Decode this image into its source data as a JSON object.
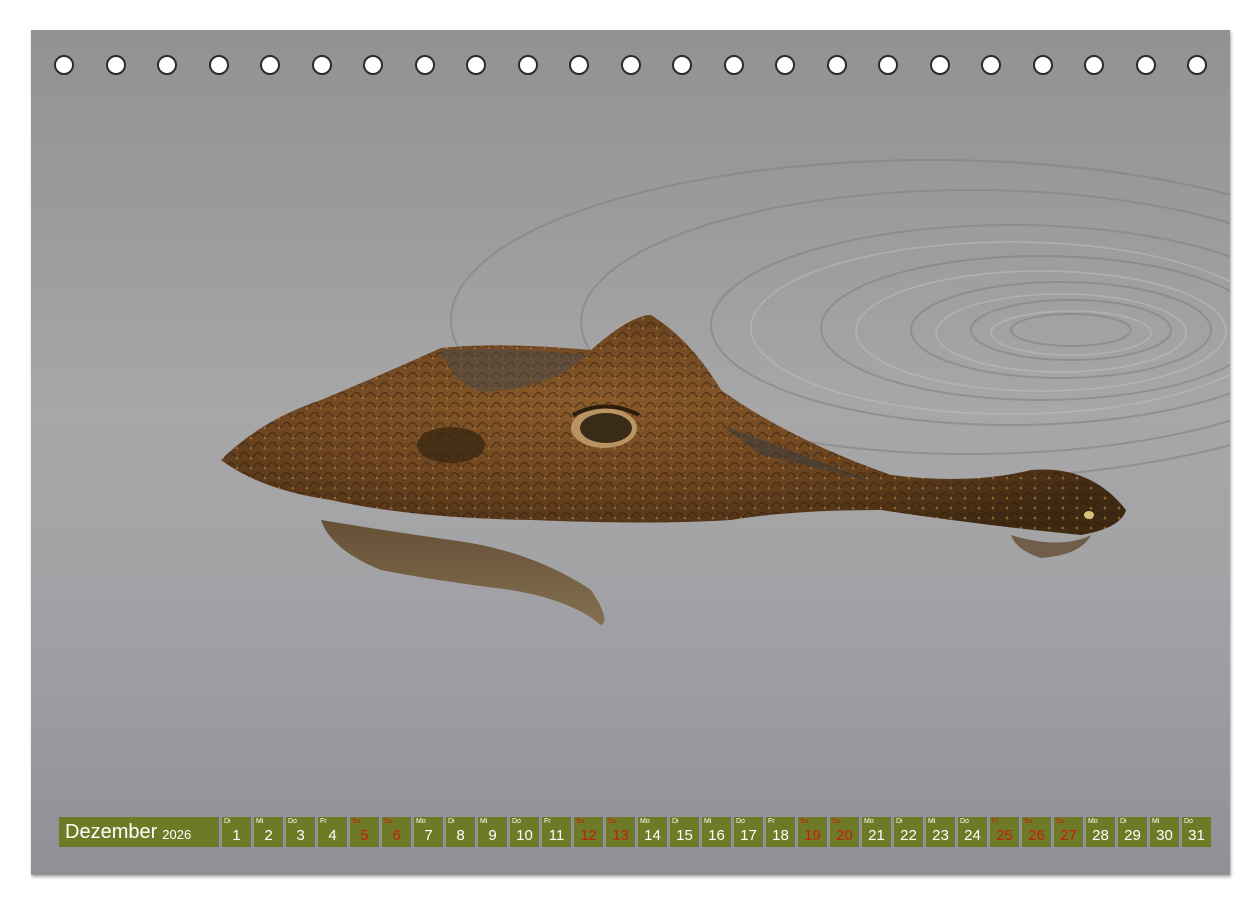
{
  "calendar": {
    "month": "Dezember",
    "year": "2026",
    "days": [
      {
        "num": "1",
        "wd": "Di",
        "red": false
      },
      {
        "num": "2",
        "wd": "Mi",
        "red": false
      },
      {
        "num": "3",
        "wd": "Do",
        "red": false
      },
      {
        "num": "4",
        "wd": "Fr",
        "red": false
      },
      {
        "num": "5",
        "wd": "Sa",
        "red": true
      },
      {
        "num": "6",
        "wd": "So",
        "red": true
      },
      {
        "num": "7",
        "wd": "Mo",
        "red": false
      },
      {
        "num": "8",
        "wd": "Di",
        "red": false
      },
      {
        "num": "9",
        "wd": "Mi",
        "red": false
      },
      {
        "num": "10",
        "wd": "Do",
        "red": false
      },
      {
        "num": "11",
        "wd": "Fr",
        "red": false
      },
      {
        "num": "12",
        "wd": "Sa",
        "red": true
      },
      {
        "num": "13",
        "wd": "So",
        "red": true
      },
      {
        "num": "14",
        "wd": "Mo",
        "red": false
      },
      {
        "num": "15",
        "wd": "Di",
        "red": false
      },
      {
        "num": "16",
        "wd": "Mi",
        "red": false
      },
      {
        "num": "17",
        "wd": "Do",
        "red": false
      },
      {
        "num": "18",
        "wd": "Fr",
        "red": false
      },
      {
        "num": "19",
        "wd": "Sa",
        "red": true
      },
      {
        "num": "20",
        "wd": "So",
        "red": true
      },
      {
        "num": "21",
        "wd": "Mo",
        "red": false
      },
      {
        "num": "22",
        "wd": "Di",
        "red": false
      },
      {
        "num": "23",
        "wd": "Mi",
        "red": false
      },
      {
        "num": "24",
        "wd": "Do",
        "red": false
      },
      {
        "num": "25",
        "wd": "Fr",
        "red": true
      },
      {
        "num": "26",
        "wd": "Sa",
        "red": true
      },
      {
        "num": "27",
        "wd": "So",
        "red": true
      },
      {
        "num": "28",
        "wd": "Mo",
        "red": false
      },
      {
        "num": "29",
        "wd": "Di",
        "red": false
      },
      {
        "num": "30",
        "wd": "Mi",
        "red": false
      },
      {
        "num": "31",
        "wd": "Do",
        "red": false
      }
    ]
  },
  "colors": {
    "bar": "#6e7a26",
    "weekend": "#c41e0e",
    "background": "#a3a3a5"
  },
  "binding_holes": 23
}
